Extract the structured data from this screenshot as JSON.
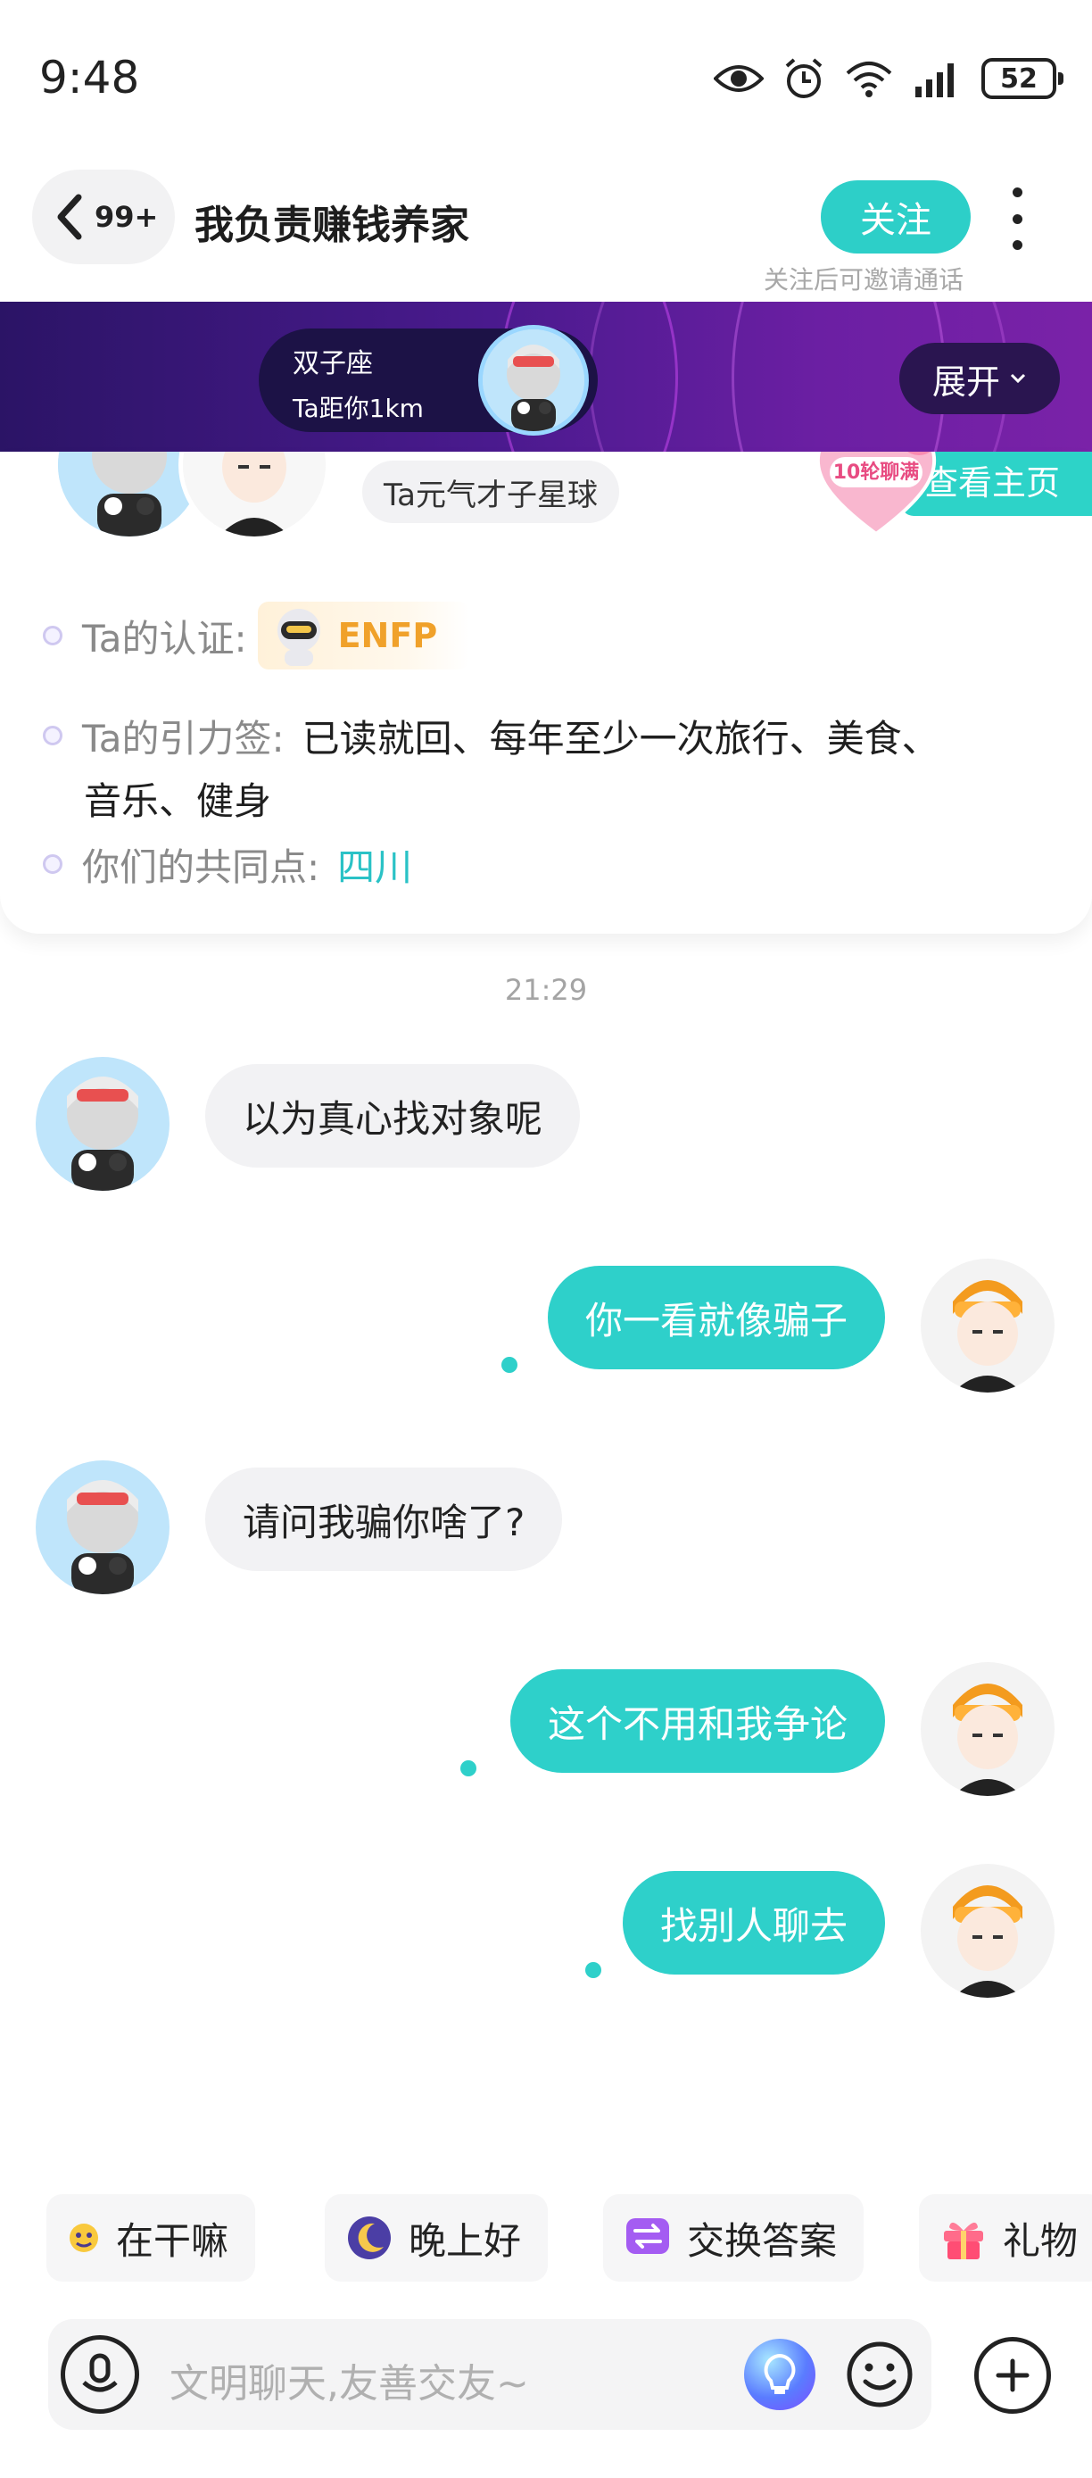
{
  "status_bar": {
    "time": "9:48",
    "battery": "52"
  },
  "header": {
    "back_count": "99+",
    "title": "我负责赚钱养家",
    "follow_label": "关注",
    "follow_hint": "关注后可邀请通话"
  },
  "banner": {
    "zodiac": "双子座",
    "distance": "Ta距你1km",
    "expand_label": "展开"
  },
  "profile": {
    "planet": "Ta元气才子星球",
    "view_page": "查看主页",
    "heart_badge": "10轮聊满",
    "cert_label": "Ta的认证:",
    "mbti": "ENFP",
    "tags_label": "Ta的引力签:",
    "tags_line1": "已读就回、每年至少一次旅行、美食、",
    "tags_line2": "音乐、健身",
    "common_label": "你们的共同点:",
    "common_value": "四川"
  },
  "chat": {
    "timestamp": "21:29",
    "messages": [
      {
        "side": "in",
        "text": "以为真心找对象呢"
      },
      {
        "side": "out",
        "text": "你一看就像骗子"
      },
      {
        "side": "in",
        "text": "请问我骗你啥了?"
      },
      {
        "side": "out",
        "text": "这个不用和我争论"
      },
      {
        "side": "out",
        "text": "找别人聊去"
      }
    ]
  },
  "quick_replies": [
    {
      "label": "在干嘛",
      "icon": "emoji-icon"
    },
    {
      "label": "晚上好",
      "icon": "moon-icon"
    },
    {
      "label": "交换答案",
      "icon": "swap-icon"
    },
    {
      "label": "礼物",
      "icon": "gift-icon"
    }
  ],
  "input": {
    "placeholder": "文明聊天,友善交友~"
  },
  "colors": {
    "accent": "#2ed0ca",
    "banner": "#4a1a8e",
    "mbti": "#f0a12a"
  }
}
